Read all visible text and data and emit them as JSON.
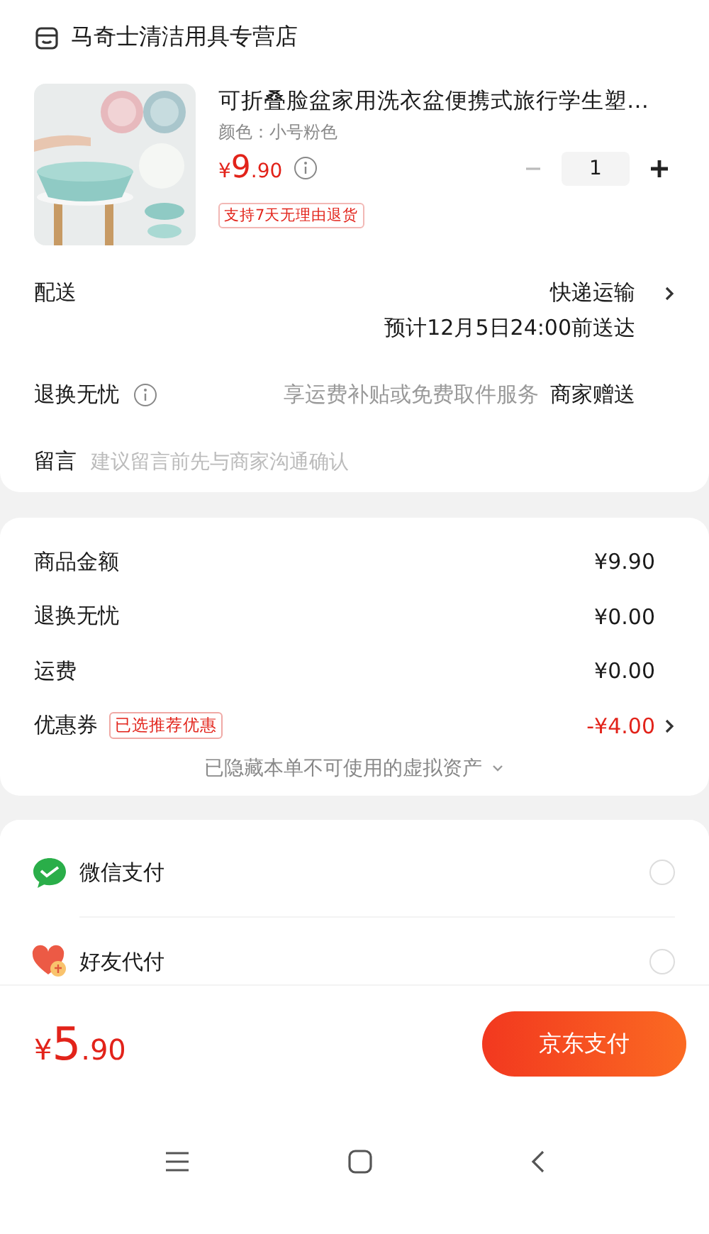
{
  "store": {
    "name": "马奇士清洁用具专营店"
  },
  "product": {
    "title": "可折叠脸盆家用洗衣盆便携式旅行学生塑…",
    "spec": "颜色：小号粉色",
    "price": {
      "currency": "¥",
      "integer": "9",
      "decimal": ".90"
    },
    "quantity": "1",
    "tag": "支持7天无理由退货",
    "minus_disabled": true
  },
  "delivery": {
    "label": "配送",
    "method": "快递运输",
    "eta": "预计12月5日24:00前送达"
  },
  "return_service": {
    "label": "退换无忧",
    "note": "享运费补贴或免费取件服务",
    "value": "商家赠送"
  },
  "message": {
    "label": "留言",
    "placeholder": "建议留言前先与商家沟通确认"
  },
  "summary": [
    {
      "label": "商品金额",
      "value": "¥9.90",
      "kind": "plain"
    },
    {
      "label": "退换无忧",
      "value": "¥0.00",
      "kind": "plain"
    },
    {
      "label": "运费",
      "value": "¥0.00",
      "kind": "plain"
    },
    {
      "label": "优惠券",
      "badge": "已选推荐优惠",
      "value": "-¥4.00",
      "kind": "discount"
    }
  ],
  "hidden_assets": "已隐藏本单不可使用的虚拟资产",
  "payments": [
    {
      "name": "微信支付",
      "kind": "wechat",
      "selected": false
    },
    {
      "name": "好友代付",
      "kind": "friend",
      "selected": false
    }
  ],
  "footer": {
    "total": {
      "currency": "¥",
      "integer": "5",
      "decimal": ".90"
    },
    "pay_button": "京东支付"
  }
}
